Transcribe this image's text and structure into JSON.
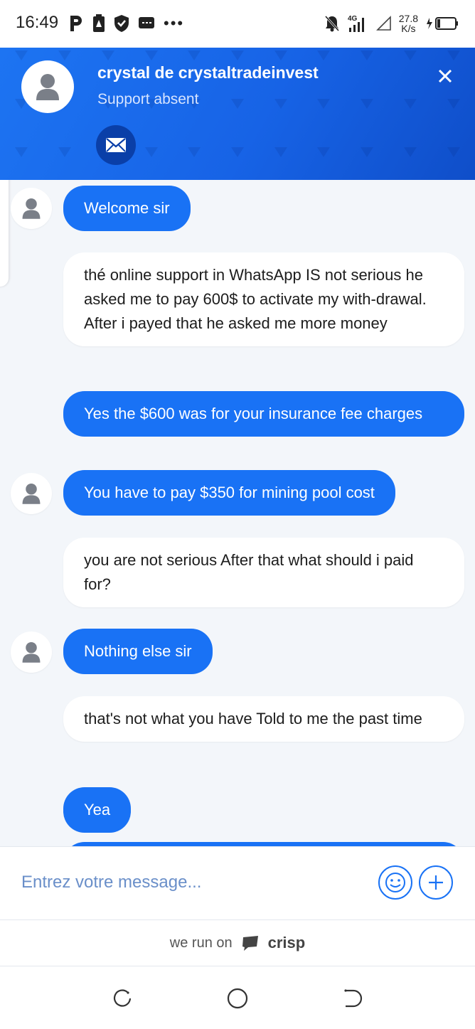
{
  "status_bar": {
    "time": "16:49",
    "network": "4G",
    "speed_value": "27.8",
    "speed_unit": "K/s"
  },
  "header": {
    "title": "crystal de crystaltradeinvest",
    "subtitle": "Support absent"
  },
  "messages": [
    {
      "from": "operator",
      "text": "Welcome sir"
    },
    {
      "from": "user",
      "text": "thé online support in WhatsApp IS not serious he asked me to pay 600$ to activate my with-drawal. After i payed that he asked me more money"
    },
    {
      "from": "operator",
      "text": "Yes the $600 was for your insurance fee charges"
    },
    {
      "from": "operator",
      "text": "You have to pay $350 for mining pool cost"
    },
    {
      "from": "user",
      "text": "you are not serious After that what should i paid for?"
    },
    {
      "from": "operator",
      "text": "Nothing else sir"
    },
    {
      "from": "user",
      "text": "that's not what you have Told to me the past time"
    },
    {
      "from": "operator",
      "text": "Yea"
    }
  ],
  "composer": {
    "placeholder": "Entrez votre message..."
  },
  "branding": {
    "prefix": "we run on",
    "name": "crisp"
  },
  "colors": {
    "accent": "#1972f5",
    "header_dark": "#0f4ec9",
    "chat_bg": "#f3f6fa"
  },
  "icons": [
    "user-avatar-icon",
    "close-icon",
    "mail-icon",
    "emoji-icon",
    "plus-icon",
    "crisp-logo-icon",
    "recents-icon",
    "home-icon",
    "back-icon"
  ]
}
